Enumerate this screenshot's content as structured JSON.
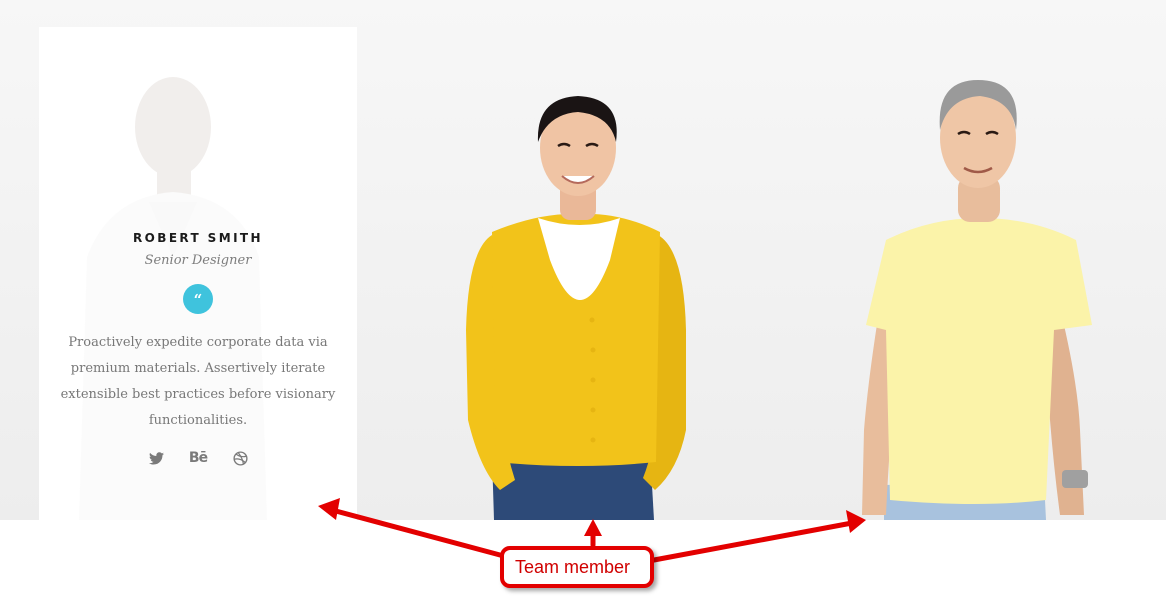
{
  "team": {
    "members": [
      {
        "name": "ROBERT SMITH",
        "role": "Senior Designer",
        "quote_glyph": "“",
        "bio": "Proactively expedite corporate data via premium materials. Assertively iterate extensible best practices before visionary functionalities.",
        "socials": [
          {
            "icon": "twitter-icon"
          },
          {
            "icon": "behance-icon",
            "glyph": "Bē"
          },
          {
            "icon": "dribbble-icon"
          }
        ]
      },
      {
        "photo": "woman-in-yellow-cardigan-photo"
      },
      {
        "photo": "man-in-yellow-tshirt-photo"
      }
    ]
  },
  "annotation": {
    "label": "Team member",
    "color": "#e30000"
  },
  "colors": {
    "accent": "#3fc3dd",
    "text_muted": "#777777",
    "cardigan": "#f2c31a",
    "tshirt": "#fbf3a9"
  }
}
